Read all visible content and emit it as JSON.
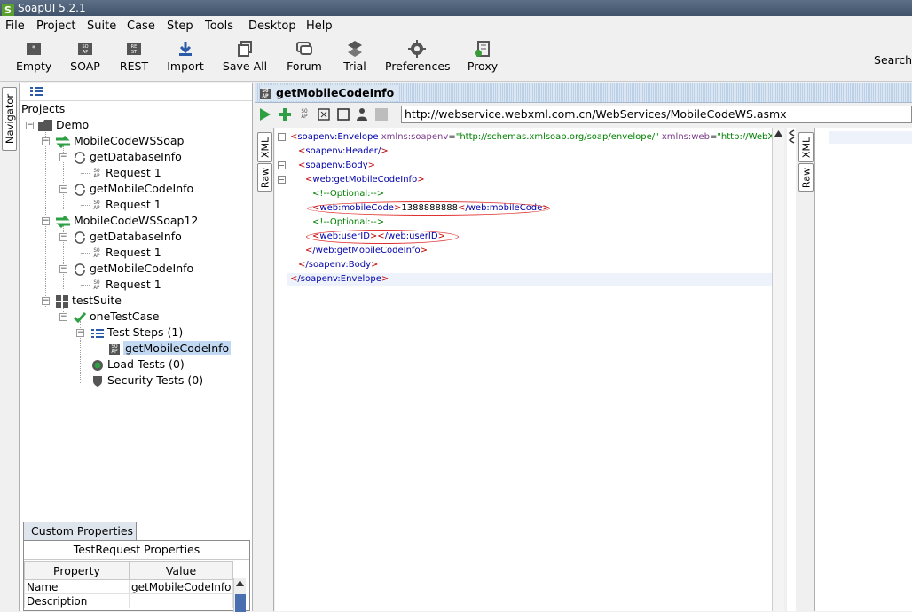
{
  "window": {
    "title": "SoapUI 5.2.1"
  },
  "menu": [
    "File",
    "Project",
    "Suite",
    "Case",
    "Step",
    "Tools",
    "Desktop",
    "Help"
  ],
  "toolbar": {
    "buttons": [
      "Empty",
      "SOAP",
      "REST",
      "Import",
      "Save All",
      "Forum",
      "Trial",
      "Preferences",
      "Proxy"
    ],
    "search_label": "Search"
  },
  "navigator": {
    "tab_label": "Navigator",
    "root_label": "Projects",
    "tree": {
      "project": "Demo",
      "iface1": "MobileCodeWSSoap",
      "iface2": "MobileCodeWSSoap12",
      "op_db": "getDatabaseInfo",
      "op_mobile": "getMobileCodeInfo",
      "request": "Request 1",
      "suite": "testSuite",
      "testcase": "oneTestCase",
      "test_steps": "Test Steps (1)",
      "step": "getMobileCodeInfo",
      "load_tests": "Load Tests (0)",
      "security_tests": "Security Tests (0)"
    }
  },
  "properties": {
    "tab": "Custom Properties",
    "title": "TestRequest Properties",
    "col_property": "Property",
    "col_value": "Value",
    "rows": [
      {
        "name": "Name",
        "value": "getMobileCodeInfo"
      },
      {
        "name": "Description",
        "value": ""
      }
    ]
  },
  "editor": {
    "title": "getMobileCodeInfo",
    "url": "http://webservice.webxml.com.cn/WebServices/MobileCodeWS.asmx",
    "side_tabs": [
      "XML",
      "Raw"
    ],
    "xml": {
      "envelope_open": "soapenv:Envelope",
      "ns_soapenv_attr": "xmlns:soapenv",
      "ns_soapenv_val": "\"http://schemas.xmlsoap.org/soap/envelope/\"",
      "ns_web_attr": "xmlns:web",
      "ns_web_val": "\"http://WebXml.co",
      "header": "soapenv:Header/",
      "body": "soapenv:Body",
      "op": "web:getMobileCodeInfo",
      "comment": "<!--Optional:-->",
      "mobile_tag": "web:mobileCode",
      "mobile_value": "1388888888",
      "mobile_close": "/web:mobileCode",
      "userid_tag": "web:userID",
      "userid_close": "/web:userID",
      "op_close": "/web:getMobileCodeInfo",
      "body_close": "/soapenv:Body",
      "envelope_close": "/soapenv:Envelope"
    }
  },
  "response": {
    "side_tabs": [
      "XML",
      "Raw"
    ]
  },
  "colors": {
    "accent_green": "#2ea043",
    "highlight_oval": "#e03030",
    "selection": "#c2d9f4"
  }
}
